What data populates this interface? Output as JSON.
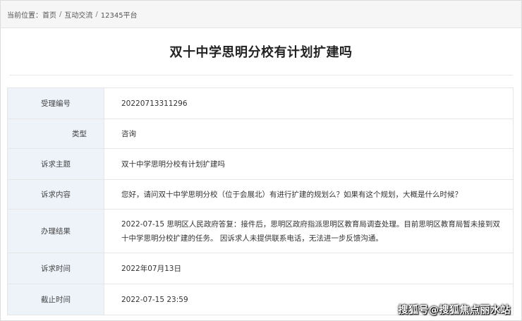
{
  "breadcrumb": {
    "prefix": "当前位置：",
    "items": [
      "首页",
      "互动交流",
      "12345平台"
    ],
    "separator": "/"
  },
  "page_title": "双十中学思明分校有计划扩建吗",
  "rows": [
    {
      "label": "受理编号",
      "value": "20220713311296"
    },
    {
      "label": "类型",
      "value": "咨询"
    },
    {
      "label": "诉求主题",
      "value": "双十中学思明分校有计划扩建吗"
    },
    {
      "label": "诉求内容",
      "value": "您好，请问双十中学思明分校（位于会展北）有进行扩建的规划么？如果有这个规划，大概是什么时候？"
    },
    {
      "label": "办理结果",
      "value": "2022-07-15 思明区人民政府答复：接件后，思明区政府指派思明区教育局调查处理。目前思明区教育局暂未接到双十中学思明分校扩建的任务。 因诉求人未提供联系电话，无法进一步反馈沟通。"
    },
    {
      "label": "诉求时间",
      "value": "2022年07月13日"
    },
    {
      "label": "截止时间",
      "value": "2022-07-15 23:59"
    }
  ],
  "watermark": "搜狐号@搜狐焦点丽水站",
  "colors": {
    "label_bg": "#eef3fa",
    "border": "#e6e6e6",
    "breadcrumb_bg": "#f6f6f6"
  }
}
